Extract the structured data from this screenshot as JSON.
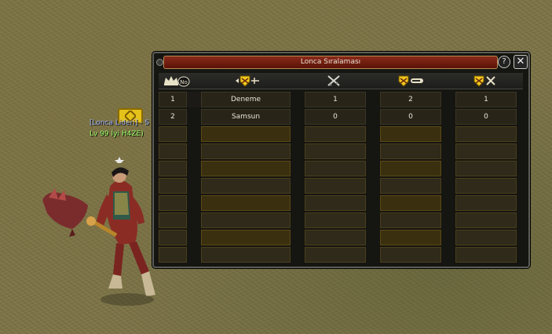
{
  "world": {
    "character_name": "[Lonca Lideri] - S",
    "character_level": "Lv 99 Íyi  H4ZE)"
  },
  "window": {
    "title": "Lonca Sıralaması",
    "help_label": "?",
    "close_label": "✕"
  },
  "table": {
    "columns": [
      {
        "icon": "crown-rank-icon",
        "label": "No"
      },
      {
        "icon": "guild-name-icon",
        "label": ""
      },
      {
        "icon": "crossed-swords-icon",
        "label": ""
      },
      {
        "icon": "guild-win-icon",
        "label": ""
      },
      {
        "icon": "guild-loss-icon",
        "label": ""
      }
    ],
    "rows": [
      {
        "no": "1",
        "name": "Deneme",
        "a": "1",
        "b": "2",
        "c": "1"
      },
      {
        "no": "2",
        "name": "Samsun",
        "a": "0",
        "b": "0",
        "c": "0"
      }
    ],
    "empty_rows": 8
  },
  "colors": {
    "title_bar": "#7a2414",
    "window_bg": "#151511",
    "row_gold": "#3a300f",
    "emblem_gold": "#e4c21a"
  }
}
